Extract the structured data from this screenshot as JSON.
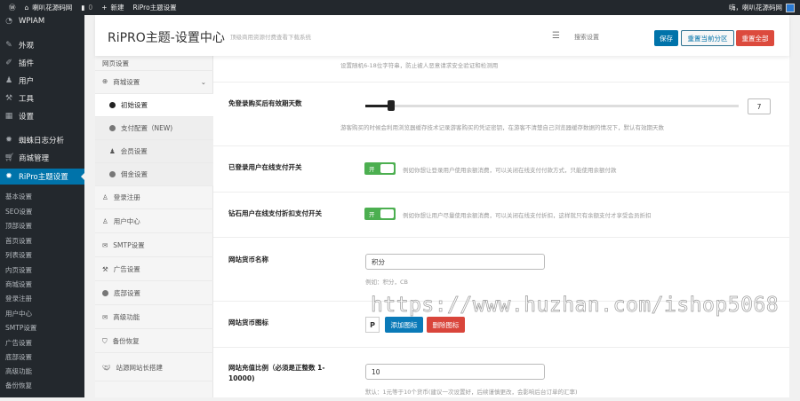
{
  "adminbar": {
    "site": "喇叭花源码网",
    "comments": "0",
    "new": "新建",
    "page": "RiPro主题设置",
    "greeting": "嗨，喇叭花源码网"
  },
  "sidebar": {
    "items": [
      {
        "label": "WPIAM",
        "icon": "gauge-icon"
      },
      {
        "label": "外观",
        "icon": "brush-icon"
      },
      {
        "label": "插件",
        "icon": "plugin-icon"
      },
      {
        "label": "用户",
        "icon": "user-icon"
      },
      {
        "label": "工具",
        "icon": "wrench-icon"
      },
      {
        "label": "设置",
        "icon": "settings-icon"
      },
      {
        "label": "蜘蛛日志分析",
        "icon": "gear-icon"
      },
      {
        "label": "商城管理",
        "icon": "cart-icon"
      },
      {
        "label": "RiPro主题设置",
        "icon": "gear-icon"
      }
    ],
    "submenu": [
      "基本设置",
      "SEO设置",
      "顶部设置",
      "首页设置",
      "列表设置",
      "内页设置",
      "商城设置",
      "登录注册",
      "用户中心",
      "SMTP设置",
      "广告设置",
      "底部设置",
      "高级功能",
      "备份恢复"
    ]
  },
  "header": {
    "title": "RiPRO主题-设置中心",
    "subtitle": "顶级商用资源付费查看下载系统",
    "search_placeholder": "搜索设置",
    "save": "保存",
    "reset_section": "重置当前分区",
    "reset_all": "重置全部"
  },
  "nav": {
    "partial": "网页设置",
    "shop": "商城设置",
    "items": [
      {
        "label": "初始设置"
      },
      {
        "label": "支付配置（NEW)"
      },
      {
        "label": "会员设置"
      },
      {
        "label": "佣金设置"
      }
    ],
    "sections": [
      "登录注册",
      "用户中心",
      "SMTP设置",
      "广告设置",
      "底部设置",
      "高级功能",
      "备份恢复",
      "站源网站长搭建"
    ]
  },
  "main": {
    "top_desc": "设置随机6-18位字符串，防止被人恶意请求安全验证和检测用",
    "slider": {
      "label": "免登录购买后有效期天数",
      "value": "7",
      "fraction": 0.07,
      "desc": "游客购买的时候会利用浏览器缓存技术记录游客购买的凭证密钥，在游客不清楚自己浏览器缓存数据的情况下，默认有效期天数"
    },
    "toggle1": {
      "label": "已登录用户在线支付开关",
      "state": "开",
      "desc": "例如你想让登录用户使用余额消费，可以关闭在线支付付款方式，只能使用余额付款"
    },
    "toggle2": {
      "label": "钻石用户在线支付折扣支付开关",
      "state": "开",
      "desc": "例如你想让用户尽量使用余额消费，可以关闭在线支付折扣，这样就只有余额支付才享受会员折扣"
    },
    "currency": {
      "label": "网站货币名称",
      "value": "积分",
      "example": "例如：积分，CB"
    },
    "icon": {
      "label": "网站货币图标",
      "add": "添加图标",
      "remove": "删除图标"
    },
    "ratio": {
      "label": "网站充值比例（必须是正整数 1-10000)",
      "value": "10",
      "desc": "默认：1元等于10个货币(建议一次设置好，后续谨慎更改，会影响后台订单的汇率)"
    }
  },
  "watermark": "https://www.huzhan.com/ishop5068"
}
